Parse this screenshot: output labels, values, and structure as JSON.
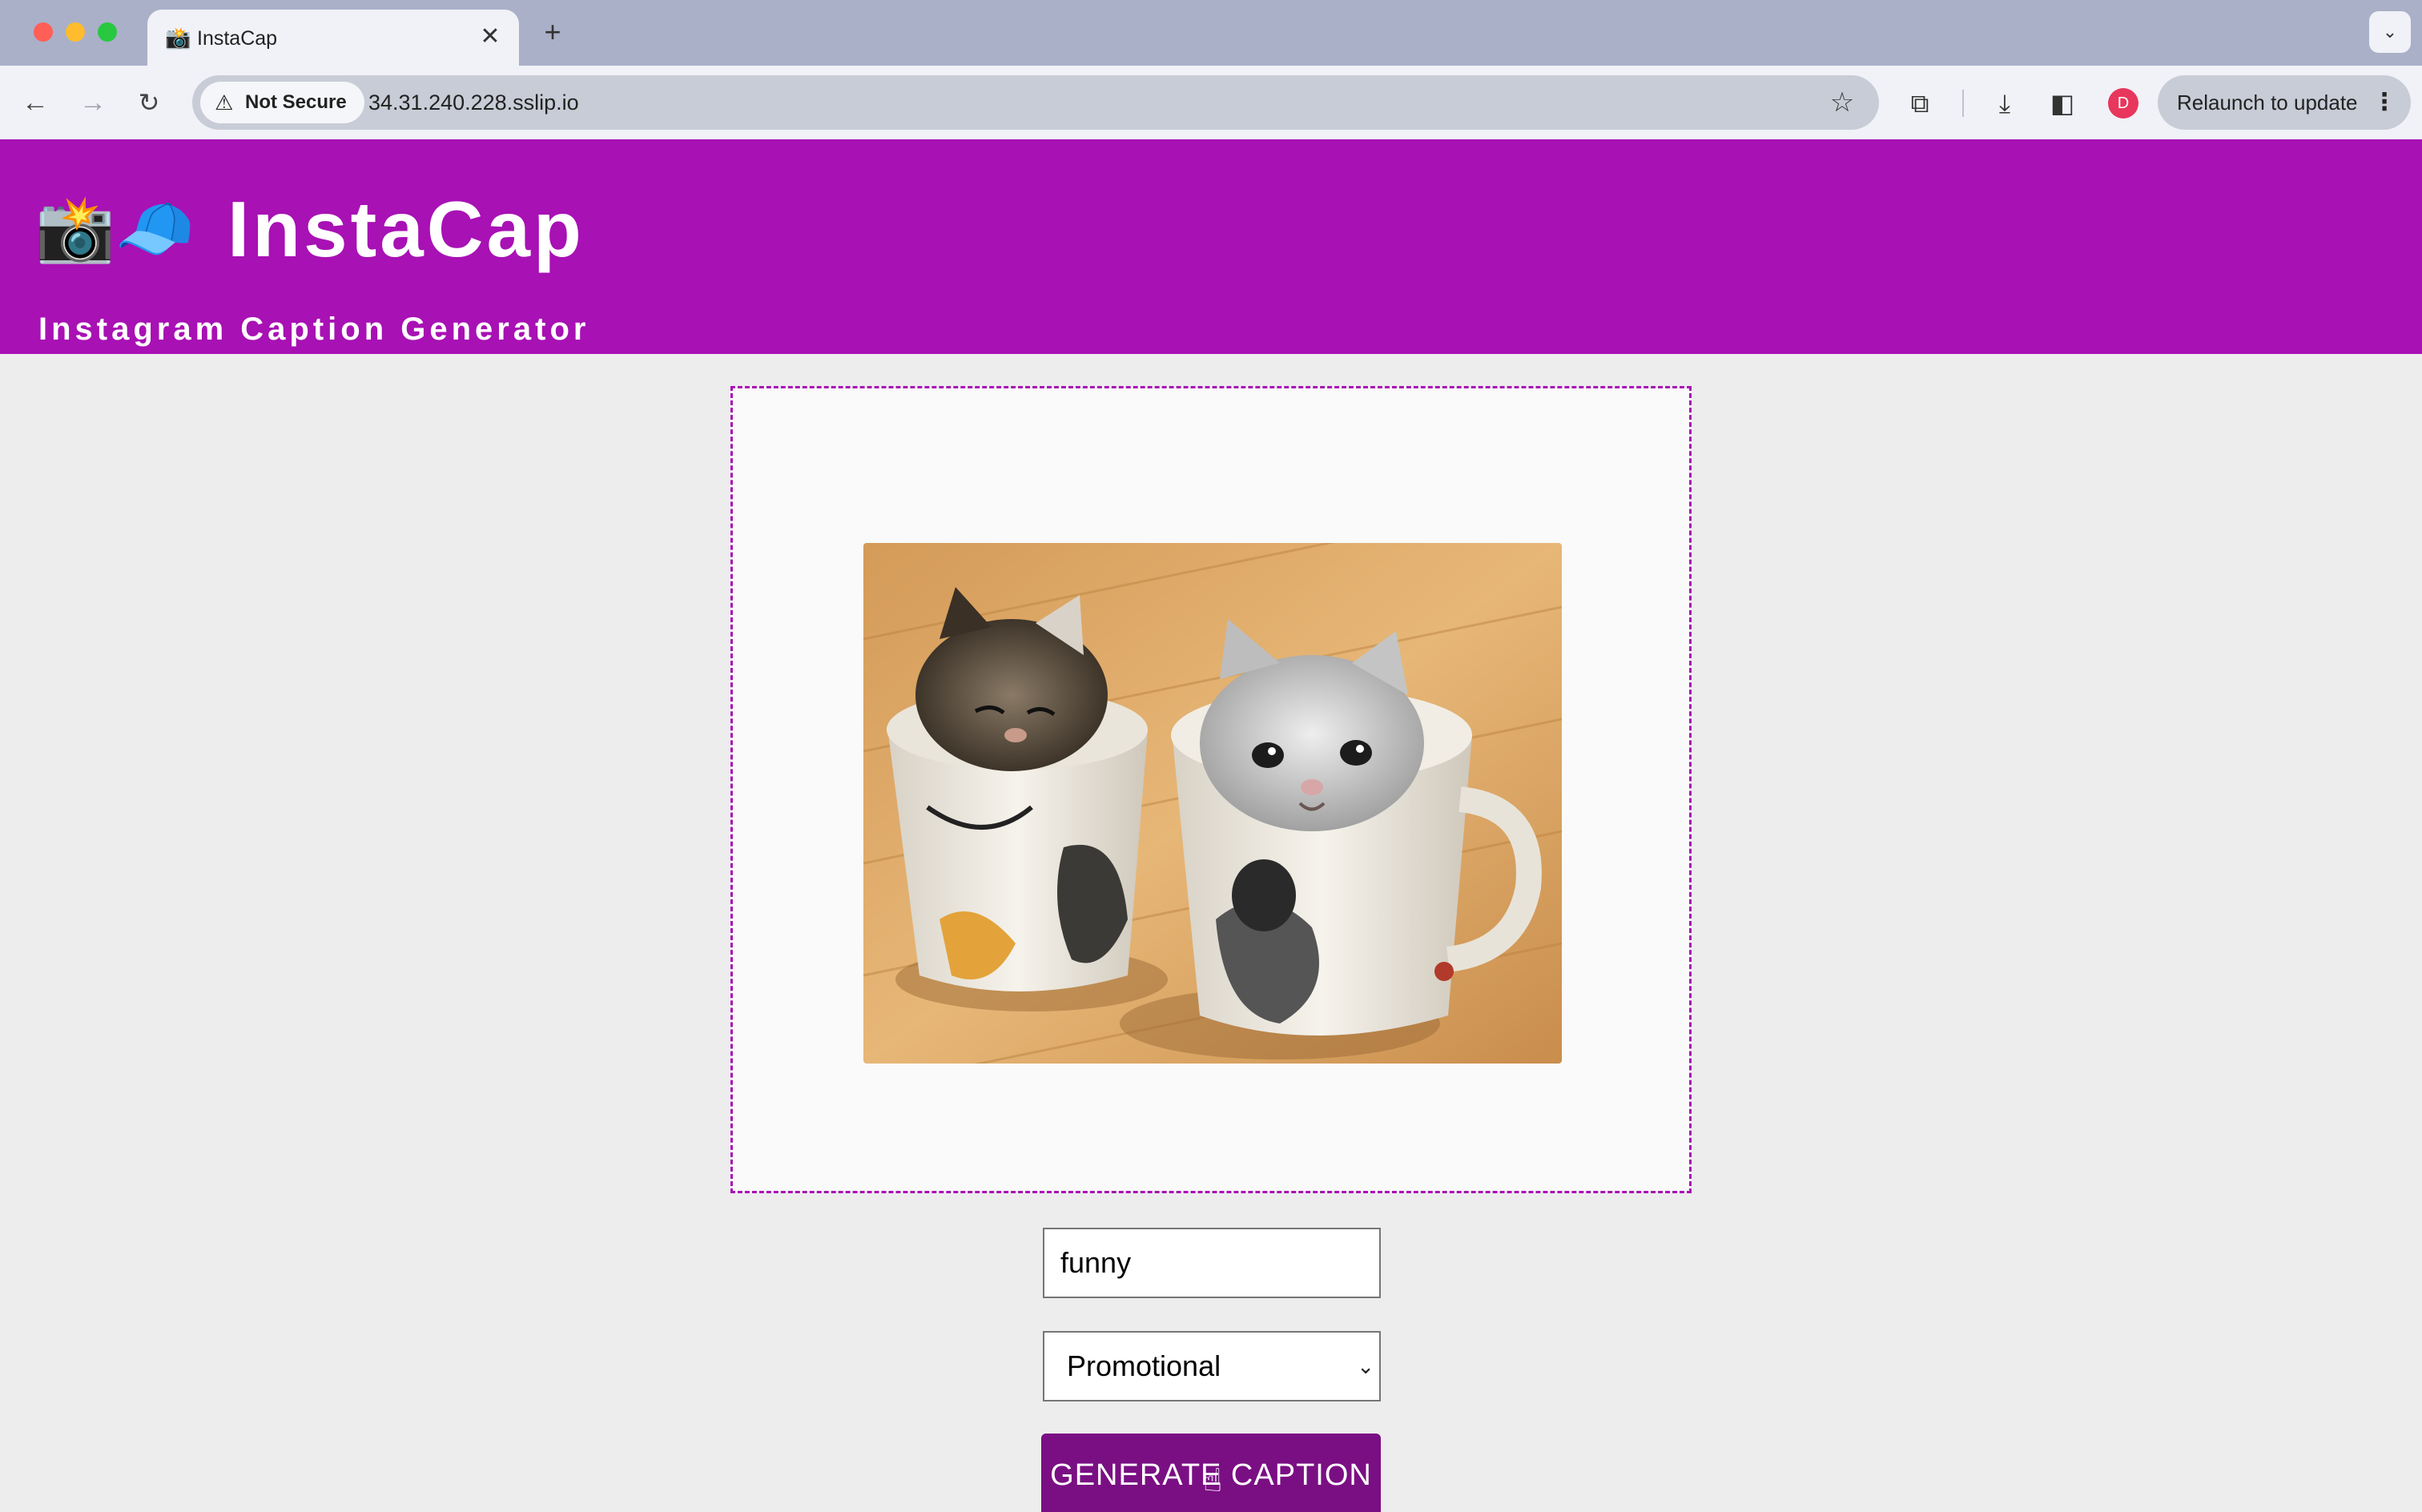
{
  "browser": {
    "tab_title": "InstaCap",
    "tab_favicon": "📸",
    "close_glyph": "✕",
    "new_tab_glyph": "+",
    "tab_menu_glyph": "⌄",
    "security_label": "Not Secure",
    "url": "34.31.240.228.sslip.io",
    "profile_initial": "D",
    "relaunch_label": "Relaunch to update",
    "relaunch_menu_glyph": "⋮",
    "icons": {
      "back": "←",
      "forward": "→",
      "reload": "↻",
      "warning": "⚠",
      "star": "☆",
      "extensions": "⧉",
      "download": "⤓",
      "side_panel": "◧"
    }
  },
  "app": {
    "logo_emoji": "📸🧢",
    "title": "InstaCap",
    "subtitle": "Instagram Caption Generator"
  },
  "form": {
    "keyword_value": "funny",
    "style_selected": "Promotional",
    "select_chevron": "⌄",
    "generate_label": "GENERATE CAPTION",
    "cursor_glyph": "☝"
  },
  "colors": {
    "brand": "#a811b4",
    "button": "#7a0f83"
  }
}
